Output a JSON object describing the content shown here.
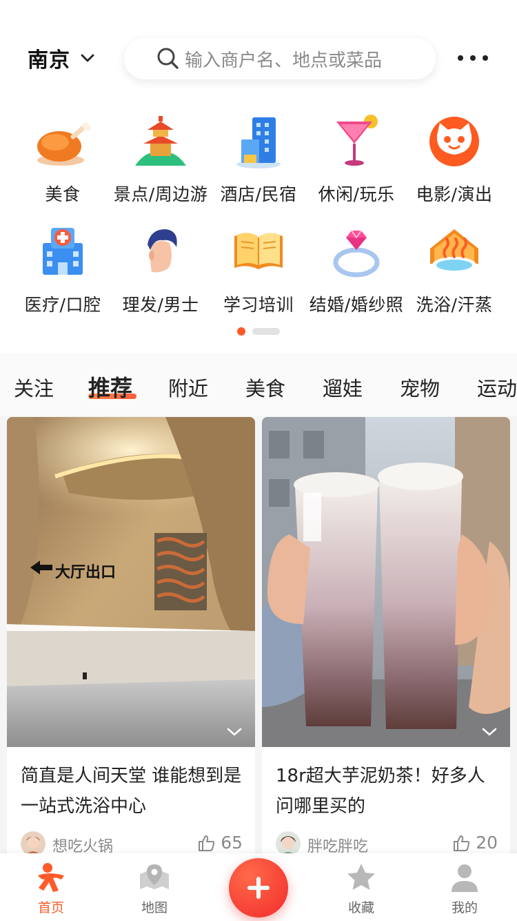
{
  "header": {
    "city": "南京",
    "search_placeholder": "输入商户名、地点或菜品"
  },
  "categories": [
    {
      "label": "美食",
      "icon": "roast-chicken-icon"
    },
    {
      "label": "景点/周边游",
      "icon": "pagoda-icon"
    },
    {
      "label": "酒店/民宿",
      "icon": "hotel-building-icon"
    },
    {
      "label": "休闲/玩乐",
      "icon": "cocktail-icon"
    },
    {
      "label": "电影/演出",
      "icon": "cat-face-icon"
    },
    {
      "label": "医疗/口腔",
      "icon": "hospital-icon"
    },
    {
      "label": "理发/男士",
      "icon": "man-head-icon"
    },
    {
      "label": "学习培训",
      "icon": "book-icon"
    },
    {
      "label": "结婚/婚纱照",
      "icon": "diamond-ring-icon"
    },
    {
      "label": "洗浴/汗蒸",
      "icon": "hot-bath-icon"
    }
  ],
  "tabs": [
    "关注",
    "推荐",
    "附近",
    "美食",
    "遛娃",
    "宠物",
    "运动"
  ],
  "active_tab": "推荐",
  "feed": [
    {
      "title": "简直是人间天堂 谁能想到是一站式洗浴中心",
      "author": "想吃火锅",
      "likes": "65",
      "sign_text": "大厅出口"
    },
    {
      "title": "18r超大芋泥奶茶！好多人问哪里买的",
      "author": "胖吃胖吃",
      "likes": "20"
    }
  ],
  "bottom_nav": [
    {
      "label": "首页",
      "icon": "home-mascot-icon",
      "active": true
    },
    {
      "label": "地图",
      "icon": "map-pin-icon",
      "active": false
    },
    {
      "label": "收藏",
      "icon": "star-icon",
      "active": false
    },
    {
      "label": "我的",
      "icon": "user-icon",
      "active": false
    }
  ],
  "colors": {
    "accent": "#ff5a2a",
    "fab": "#f22b2b"
  }
}
